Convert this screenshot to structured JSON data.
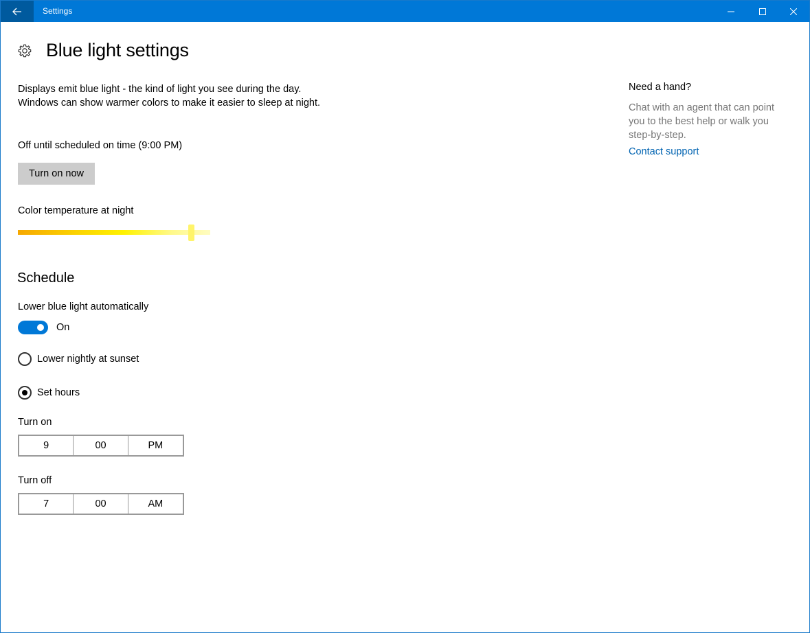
{
  "window": {
    "title": "Settings"
  },
  "header": {
    "title": "Blue light settings"
  },
  "main": {
    "description": "Displays emit blue light - the kind of light you see during the day. Windows can show warmer colors to make it easier to sleep at night.",
    "status_text": "Off until scheduled on time (9:00 PM)",
    "turn_on_button": "Turn on now",
    "color_temp_label": "Color temperature at night",
    "color_temp_level_fraction": 0.9,
    "slider_colors": [
      "#f6a800",
      "#fff200",
      "#fffcc0"
    ]
  },
  "schedule": {
    "title": "Schedule",
    "toggle_label": "Lower blue light automatically",
    "toggle_state": "On",
    "toggle_on": true,
    "radio_sunset": "Lower nightly at sunset",
    "radio_set_hours": "Set hours",
    "selected": "set_hours",
    "turn_on": {
      "label": "Turn on",
      "hour": "9",
      "minute": "00",
      "period": "PM"
    },
    "turn_off": {
      "label": "Turn off",
      "hour": "7",
      "minute": "00",
      "period": "AM"
    }
  },
  "help": {
    "title": "Need a hand?",
    "text": "Chat with an agent that can point you to the best help or walk you step-by-step.",
    "link": "Contact support"
  },
  "colors": {
    "accent": "#0078d7",
    "link": "#0063b1"
  },
  "icons": {
    "back": "back-arrow-icon",
    "minimize": "minimize-icon",
    "maximize": "maximize-icon",
    "close": "close-icon",
    "page": "gear-icon"
  }
}
